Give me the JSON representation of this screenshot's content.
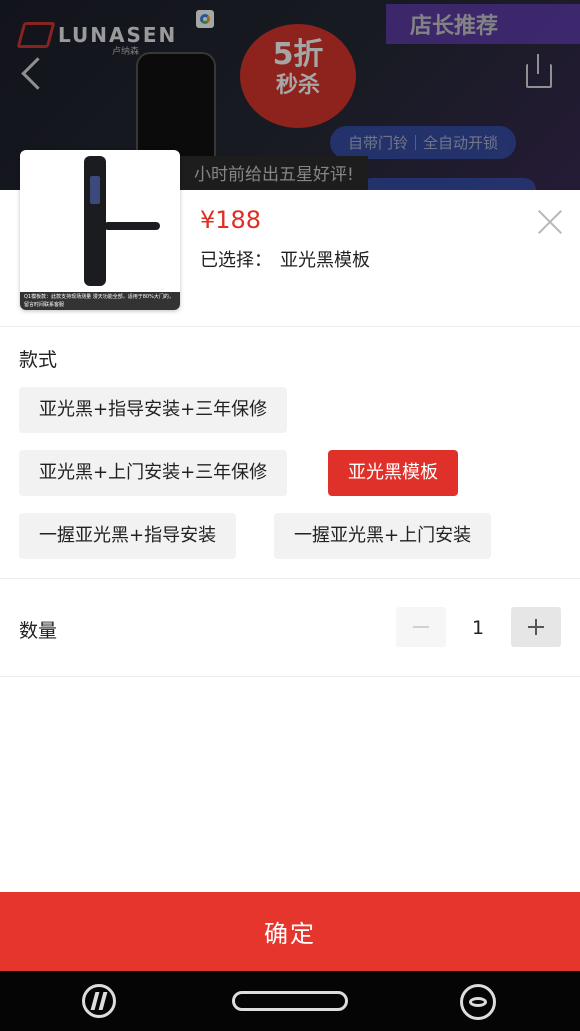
{
  "background": {
    "brand": "LUNASEN",
    "brand_sub": "卢纳森",
    "promo_tag": "店长推荐",
    "burst_line1": "5折",
    "burst_line2": "秒杀",
    "chip": "自带门铃｜全自动开锁",
    "banner": "小时前给出五星好评!"
  },
  "product": {
    "thumb_caption": "Q1模板款：此款支持现场测量 漫天功能全部，适用于80%大门的，留言时间联系客服",
    "price": "¥188",
    "selected_label": "已选择：",
    "selected_value": "亚光黑模板"
  },
  "spec": {
    "title": "款式",
    "options": [
      "亚光黑+指导安装+三年保修",
      "亚光黑+上门安装+三年保修",
      "亚光黑模板",
      "一握亚光黑+指导安装",
      "一握亚光黑+上门安装"
    ],
    "selected": "亚光黑模板"
  },
  "quantity": {
    "label": "数量",
    "value": "1"
  },
  "confirm_label": "确定",
  "colors": {
    "accent": "#e0302a",
    "price": "#e02e24",
    "chip_bg": "#f2f2f2"
  }
}
